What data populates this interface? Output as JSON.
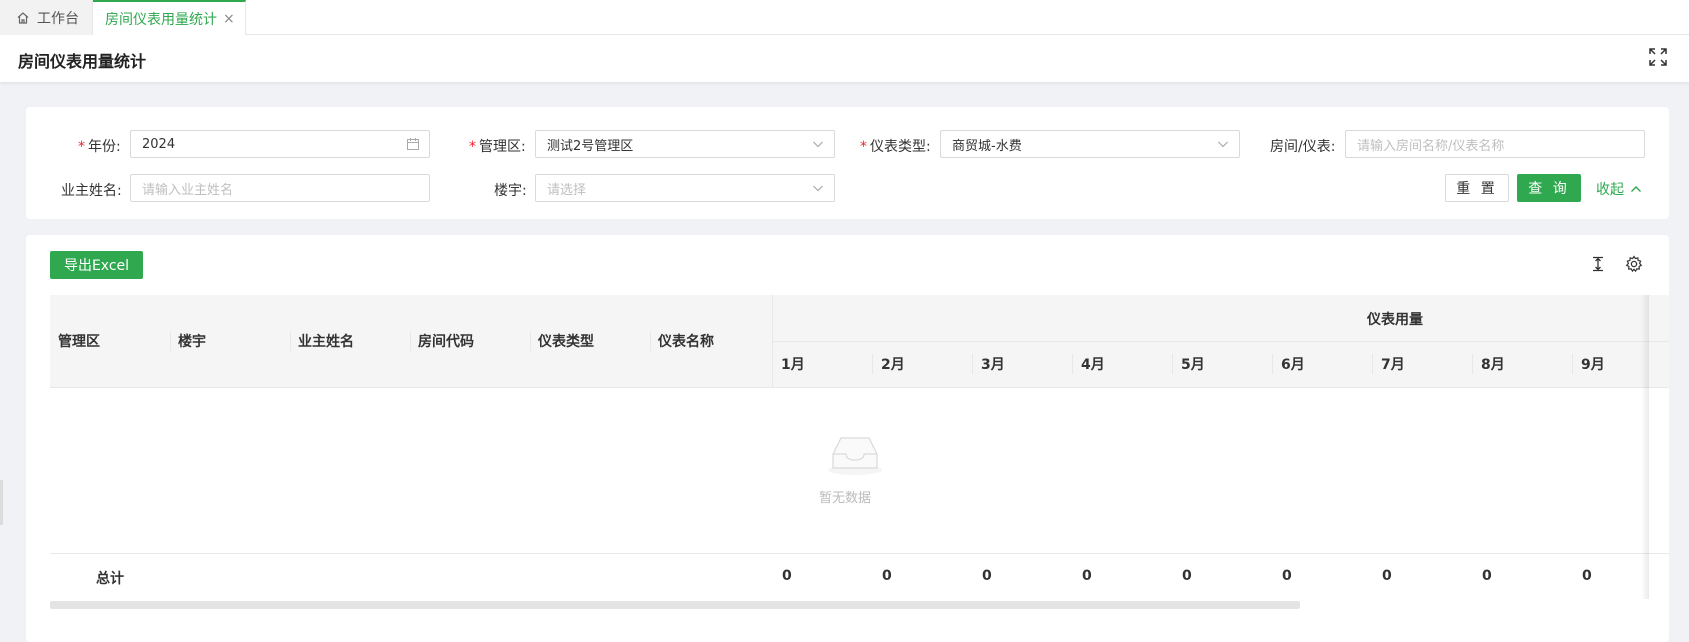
{
  "tabs": {
    "home_label": "工作台",
    "active_label": "房间仪表用量统计",
    "close_glyph": "×"
  },
  "header": {
    "title": "房间仪表用量统计"
  },
  "search": {
    "required_mark": "*",
    "year": {
      "label": "年份:",
      "value": "2024"
    },
    "area": {
      "label": "管理区:",
      "value": "测试2号管理区"
    },
    "meter_type": {
      "label": "仪表类型:",
      "value": "商贸城-水费"
    },
    "room_meter": {
      "label": "房间/仪表:",
      "placeholder": "请输入房间名称/仪表名称"
    },
    "owner_name": {
      "label": "业主姓名:",
      "placeholder": "请输入业主姓名"
    },
    "building": {
      "label": "楼宇:",
      "placeholder": "请选择"
    },
    "reset_label": "重 置",
    "query_label": "查 询",
    "collapse_label": "收起"
  },
  "toolbar": {
    "export_label": "导出Excel",
    "icons": [
      "column-height-icon",
      "settings-icon"
    ]
  },
  "table": {
    "columns": [
      "管理区",
      "楼宇",
      "业主姓名",
      "房间代码",
      "仪表类型",
      "仪表名称"
    ],
    "group_header": "仪表用量",
    "months": [
      "1月",
      "2月",
      "3月",
      "4月",
      "5月",
      "6月",
      "7月",
      "8月",
      "9月"
    ],
    "empty_text": "暂无数据",
    "total_label": "总计",
    "totals": [
      "0",
      "0",
      "0",
      "0",
      "0",
      "0",
      "0",
      "0",
      "0"
    ]
  },
  "colors": {
    "accent": "#2fa84f",
    "required": "#f5222d",
    "background": "#f0f2f5"
  }
}
